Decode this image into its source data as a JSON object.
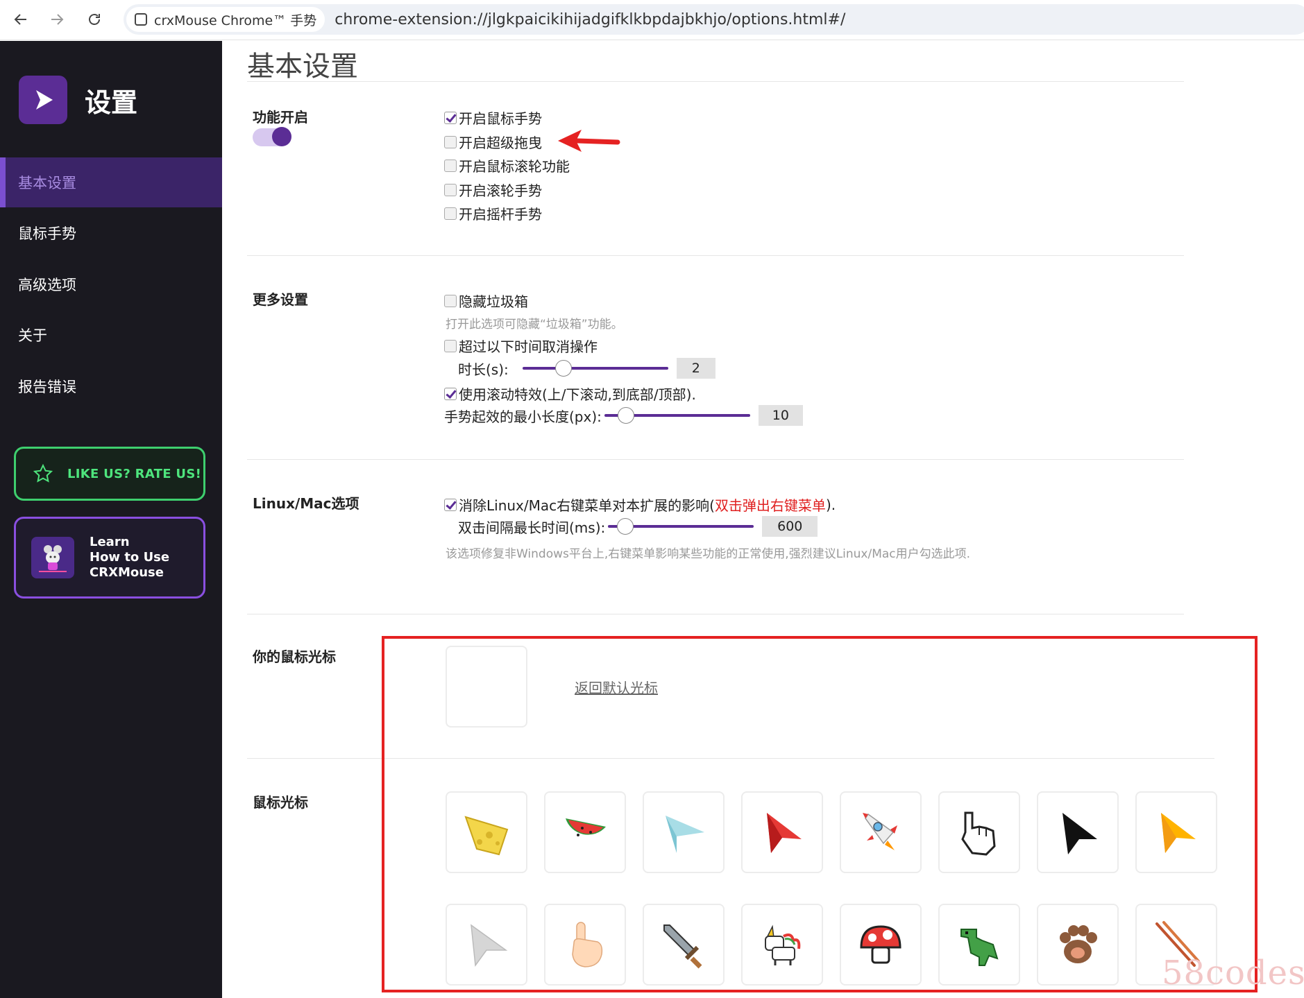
{
  "browser": {
    "tab_title": "crxMouse Chrome™ 手势",
    "url": "chrome-extension://jlgkpaicikihijadgifklkbpdajbkhjo/options.html#/"
  },
  "sidebar": {
    "title": "设置",
    "items": [
      {
        "label": "基本设置",
        "active": true
      },
      {
        "label": "鼠标手势",
        "active": false
      },
      {
        "label": "高级选项",
        "active": false
      },
      {
        "label": "关于",
        "active": false
      },
      {
        "label": "报告错误",
        "active": false
      }
    ],
    "rate_label": "LIKE US? RATE US!",
    "learn_lines": [
      "Learn",
      "How to Use",
      "CRXMouse"
    ]
  },
  "main": {
    "page_title": "基本设置",
    "feature": {
      "label": "功能开启",
      "toggle_on": true,
      "options": [
        {
          "label": "开启鼠标手势",
          "checked": true
        },
        {
          "label": "开启超级拖曳",
          "checked": false
        },
        {
          "label": "开启鼠标滚轮功能",
          "checked": false
        },
        {
          "label": "开启滚轮手势",
          "checked": false
        },
        {
          "label": "开启摇杆手势",
          "checked": false
        }
      ]
    },
    "more": {
      "label": "更多设置",
      "hide_trash": {
        "label": "隐藏垃圾箱",
        "checked": false
      },
      "hide_trash_hint": "打开此选项可隐藏“垃圾箱”功能。",
      "timeout": {
        "label": "超过以下时间取消操作",
        "checked": false
      },
      "duration_label": "时长(s):",
      "duration_value": "2",
      "duration_fraction": 0.28,
      "scroll_effect": {
        "label": "使用滚动特效(上/下滚动,到底部/顶部).",
        "checked": true
      },
      "min_length_label": "手势起效的最小长度(px):",
      "min_length_value": "10",
      "min_length_fraction": 0.15
    },
    "linux": {
      "label": "Linux/Mac选项",
      "fix_label": "消除Linux/Mac右键菜单对本扩展的影响(",
      "fix_label_red": "双击弹出右键菜单",
      "fix_label_end": ").",
      "fix_checked": true,
      "interval_label": "双击间隔最长时间(ms):",
      "interval_value": "600",
      "interval_fraction": 0.12,
      "hint": "该选项修复非Windows平台上,右键菜单影响某些功能的正常使用,强烈建议Linux/Mac用户勾选此项."
    },
    "your_cursor": {
      "label": "你的鼠标光标",
      "reset_link": "返回默认光标"
    },
    "cursors": {
      "label": "鼠标光标",
      "row1": [
        "cheese-icon",
        "watermelon-icon",
        "paper-plane-icon",
        "red-arrow-icon",
        "rocket-icon",
        "pixel-hand-icon",
        "black-arrow-icon",
        "yellow-arrow-icon"
      ],
      "row2": [
        "gray-arrow-icon",
        "pointing-hand-icon",
        "sword-icon",
        "unicorn-icon",
        "mushroom-icon",
        "dinosaur-icon",
        "paw-icon",
        "chopsticks-icon"
      ]
    }
  },
  "watermark": "58codes",
  "colors": {
    "accent": "#5b2d95",
    "sidebar_bg": "#1a1920",
    "rate_green": "#4ee57d",
    "annotation_red": "#e52222"
  }
}
